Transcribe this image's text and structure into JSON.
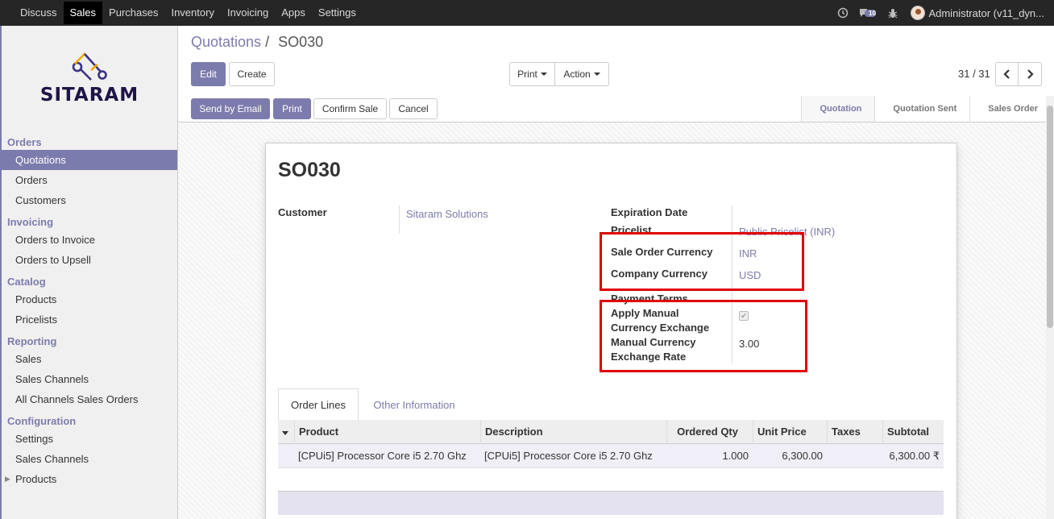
{
  "topnav": {
    "menu": [
      {
        "label": "Discuss",
        "active": false
      },
      {
        "label": "Sales",
        "active": true
      },
      {
        "label": "Purchases",
        "active": false
      },
      {
        "label": "Inventory",
        "active": false
      },
      {
        "label": "Invoicing",
        "active": false
      },
      {
        "label": "Apps",
        "active": false
      },
      {
        "label": "Settings",
        "active": false
      }
    ],
    "icons": [
      "clock-icon",
      "chat-icon",
      "bug-icon"
    ],
    "messages_badge": "10",
    "user": "Administrator (v11_dyn..."
  },
  "sidebar": {
    "logo_text": "SITARAM",
    "sections": [
      {
        "title": "Orders",
        "items": [
          "Quotations",
          "Orders",
          "Customers"
        ]
      },
      {
        "title": "Invoicing",
        "items": [
          "Orders to Invoice",
          "Orders to Upsell"
        ]
      },
      {
        "title": "Catalog",
        "items": [
          "Products",
          "Pricelists"
        ]
      },
      {
        "title": "Reporting",
        "items": [
          "Sales",
          "Sales Channels",
          "All Channels Sales Orders"
        ]
      },
      {
        "title": "Configuration",
        "items": [
          "Settings",
          "Sales Channels",
          "Products"
        ]
      }
    ],
    "active_item": "Quotations"
  },
  "breadcrumb": {
    "parent": "Quotations",
    "separator": "/",
    "current": "SO030"
  },
  "buttons": {
    "edit": "Edit",
    "create": "Create",
    "print_menu": "Print",
    "action_menu": "Action",
    "send_email": "Send by Email",
    "print": "Print",
    "confirm": "Confirm Sale",
    "cancel": "Cancel"
  },
  "pager": {
    "value": "31 / 31"
  },
  "stages": [
    "Quotation",
    "Quotation Sent",
    "Sales Order"
  ],
  "current_stage": "Quotation",
  "form": {
    "name": "SO030",
    "customer_label": "Customer",
    "customer_value": "Sitaram Solutions",
    "expiration_label": "Expiration Date",
    "pricelist_label": "Pricelist",
    "pricelist_value": "Public Pricelist (INR)",
    "so_currency_label": "Sale Order Currency",
    "so_currency_value": "INR",
    "company_currency_label": "Company Currency",
    "company_currency_value": "USD",
    "payment_terms_label": "Payment Terms",
    "manual_label_1": "Apply Manual",
    "manual_label_2": "Currency Exchange",
    "apply_manual": true,
    "rate_label_1": "Manual Currency",
    "rate_label_2": "Exchange Rate",
    "rate_value": "3.00"
  },
  "tabs": [
    "Order Lines",
    "Other Information"
  ],
  "table": {
    "columns": [
      "Product",
      "Description",
      "Ordered Qty",
      "Unit Price",
      "Taxes",
      "Subtotal"
    ],
    "rows": [
      [
        "[CPUi5] Processor Core i5 2.70 Ghz",
        "[CPUi5] Processor Core i5 2.70 Ghz",
        "1.000",
        "6,300.00",
        "",
        "6,300.00 ₹"
      ]
    ]
  }
}
